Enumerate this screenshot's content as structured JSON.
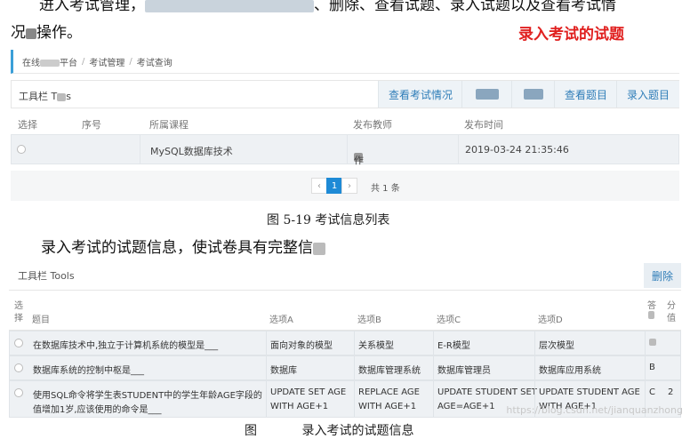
{
  "top_paragraph": {
    "line1_start": "进入考试管理，",
    "line1_end": "、删除、查看试题、录入试题以及查看考试情",
    "line2_start": "况",
    "line2_end": "操作。"
  },
  "red_annotation": "录入考试的试题",
  "breadcrumb": {
    "item1_start": "在线",
    "item1_end": "平台",
    "item2": "考试管理",
    "item3": "考试查询",
    "separator": "/"
  },
  "toolbar1": {
    "label_start": "工具栏 T",
    "label_end": "s",
    "btn_view_exam": "查看考试情况",
    "btn_view_questions": "查看题目",
    "btn_enter_questions": "录入题目"
  },
  "table1": {
    "headers": [
      "选择",
      "序号",
      "所属课程",
      "发布教师",
      "发布时间"
    ],
    "row": {
      "course": "MySQL数据库技术",
      "teacher_end": "作",
      "time": "2019-03-24 21:35:46"
    }
  },
  "pager": {
    "prev": "‹",
    "current": "1",
    "next": "›",
    "total": "共 1 条"
  },
  "caption1": "图 5-19  考试信息列表",
  "mid_paragraph": "录入考试的试题信息，使试卷具有完整信",
  "toolbar2": {
    "label": "工具栏 Tools",
    "delete": "删除"
  },
  "table2": {
    "headers": {
      "select_1": "选",
      "select_2": "择",
      "question": "题目",
      "a": "选项A",
      "b": "选项B",
      "c": "选项C",
      "d": "选项D",
      "answer": "答",
      "score_1": "分",
      "score_2": "值"
    },
    "rows": [
      {
        "question_1": "在数据库技术中,独立于计算机系统的模型是___",
        "question_2": "",
        "a_1": "面向对象的模型",
        "a_2": "",
        "b_1": "关系模型",
        "b_2": "",
        "c_1": "E-R模型",
        "c_2": "",
        "d_1": "层次模型",
        "d_2": "",
        "answer": "",
        "score": ""
      },
      {
        "question_1": "数据库系统的控制中枢是___",
        "question_2": "",
        "a_1": "数据库",
        "a_2": "",
        "b_1": "数据库管理系统",
        "b_2": "",
        "c_1": "数据库管理员",
        "c_2": "",
        "d_1": "数据库应用系统",
        "d_2": "",
        "answer": "B",
        "score": ""
      },
      {
        "question_1": "使用SQL命令将学生表STUDENT中的学生年龄AGE字段的",
        "question_2": "值增加1岁,应该使用的命令是___",
        "a_1": "UPDATE SET AGE",
        "a_2": "WITH AGE+1",
        "b_1": "REPLACE AGE",
        "b_2": "WITH AGE+1",
        "c_1": "UPDATE STUDENT SET",
        "c_2": "AGE=AGE+1",
        "d_1": "UPDATE STUDENT AGE",
        "d_2": "WITH AGE+1",
        "answer": "C",
        "score": "2"
      }
    ]
  },
  "watermark": "https://blog.csdn.net/jianquanzhong",
  "caption2_partial": "图",
  "caption2_partial2": "录入考试的试题信息"
}
